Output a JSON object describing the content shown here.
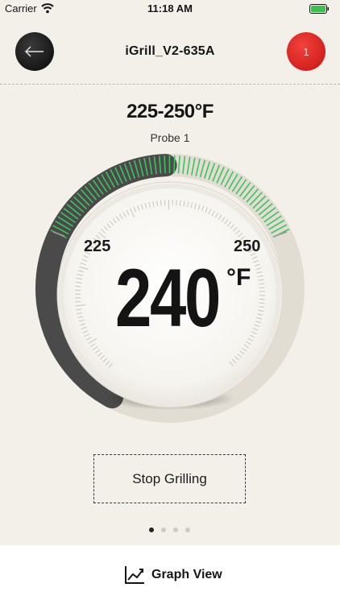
{
  "status_bar": {
    "carrier": "Carrier",
    "time": "11:18 AM"
  },
  "nav": {
    "title": "iGrill_V2-635A",
    "alert_count": "1",
    "back_icon": "arrow-left-icon"
  },
  "probe": {
    "target_range": "225-250°F",
    "label": "Probe 1",
    "range_low": "225",
    "range_high": "250",
    "temperature": "240",
    "unit": "°F"
  },
  "actions": {
    "stop_label": "Stop Grilling",
    "graph_label": "Graph View",
    "graph_icon": "line-chart-icon"
  },
  "pager": {
    "count": 4,
    "active": 0
  },
  "colors": {
    "accent_green": "#3ec25e",
    "alert_red": "#e22e28",
    "dark": "#171717",
    "background": "#f3f0ea"
  }
}
